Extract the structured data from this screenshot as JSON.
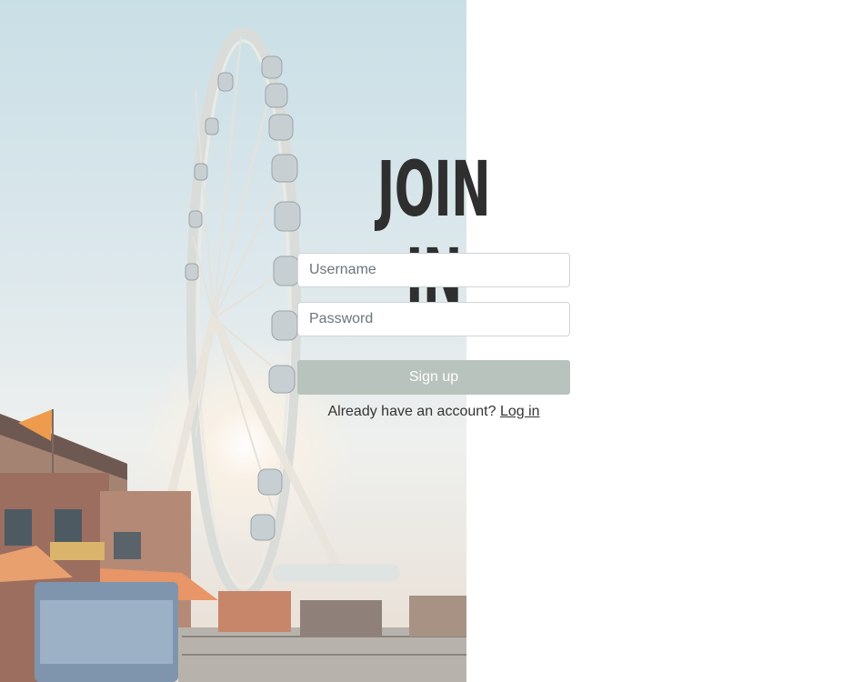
{
  "form": {
    "heading": "JOIN IN",
    "username_placeholder": "Username",
    "password_placeholder": "Password",
    "signup_label": "Sign up",
    "account_prompt": "Already have an account?",
    "login_link": "Log in"
  },
  "colors": {
    "button_bg": "#b9c3bd",
    "heading": "#2f2f2f",
    "text": "#333333"
  }
}
